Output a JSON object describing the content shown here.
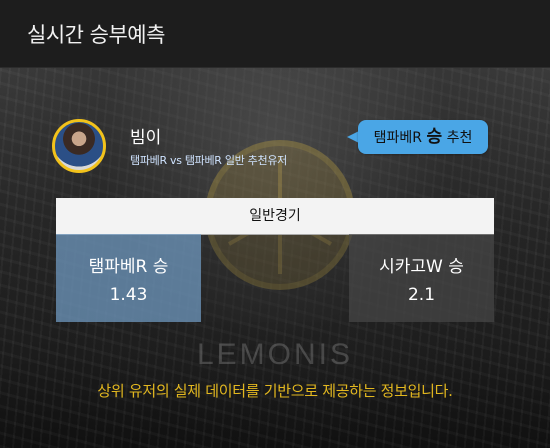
{
  "header": {
    "title": "실시간 승부예측"
  },
  "user": {
    "name": "빔이",
    "description": "탬파베R vs 탬파베R 일반 추천유저"
  },
  "recommendation": {
    "prefix": "탬파베R",
    "result": "승",
    "suffix": "추천",
    "color": "#4aa6e6"
  },
  "game": {
    "type_label": "일반경기",
    "home": {
      "name": "탬파베R 승",
      "odds": "1.43"
    },
    "away": {
      "name": "시카고W 승",
      "odds": "2.1"
    }
  },
  "background": {
    "brand": "LEMONIS"
  },
  "footer": {
    "note": "상위 유저의 실제 데이터를 기반으로 제공하는 정보입니다."
  },
  "colors": {
    "accent": "#f2c21b",
    "footer_text": "#e2b71f",
    "home_highlight": "#6c94b9"
  }
}
